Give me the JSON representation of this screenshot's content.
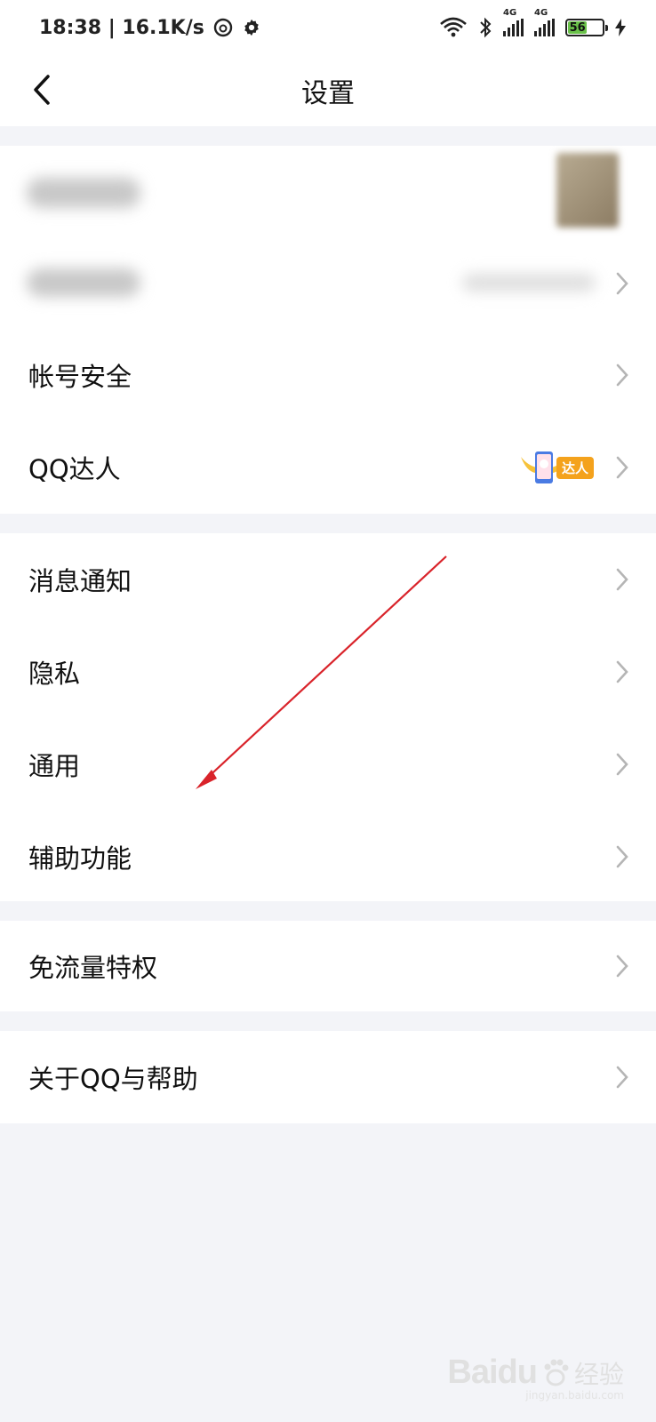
{
  "statusbar": {
    "time": "18:38 | 16.1K/s",
    "net1": "4G",
    "net2": "4G",
    "battery": "56"
  },
  "navbar": {
    "title": "设置"
  },
  "sections": [
    {
      "items": []
    },
    {
      "items": [
        {
          "label": "帐号安全"
        },
        {
          "label": "QQ达人",
          "badge": "达人"
        }
      ]
    },
    {
      "items": [
        {
          "label": "消息通知"
        },
        {
          "label": "隐私"
        },
        {
          "label": "通用"
        },
        {
          "label": "辅助功能"
        }
      ]
    },
    {
      "items": [
        {
          "label": "免流量特权"
        }
      ]
    },
    {
      "items": [
        {
          "label": "关于QQ与帮助"
        }
      ]
    }
  ],
  "watermark": {
    "brand": "Baidu",
    "cn": "经验",
    "sub": "jingyan.baidu.com"
  },
  "colors": {
    "background": "#f3f4f8",
    "section": "#ffffff",
    "annotation_arrow": "#d9232a",
    "badge": "#f4a21c"
  }
}
